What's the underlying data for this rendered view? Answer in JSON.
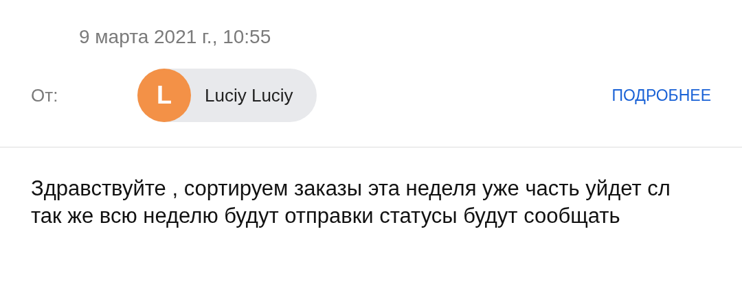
{
  "message": {
    "date": "9 марта 2021 г., 10:55",
    "from_label": "От:",
    "sender": {
      "initial": "L",
      "name": "Luciy Luciy",
      "color": "#f39147"
    },
    "details_link": "ПОДРОБНЕЕ",
    "body": "Здравствуйте , сортируем заказы эта неделя уже часть уйдет сл так же всю неделю будут отправки статусы будут сообщать"
  }
}
